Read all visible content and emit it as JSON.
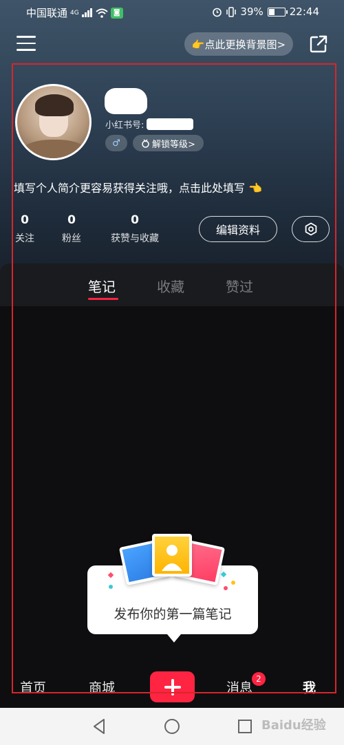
{
  "status_bar": {
    "carrier": "中国联通",
    "network": "4G",
    "battery": "39%",
    "time": "22:44"
  },
  "top_bar": {
    "change_bg_label": "👉点此更换背景图>"
  },
  "profile": {
    "redbook_id_label": "小红书号:",
    "gender_symbol": "♂",
    "unlock_level_label": "解锁等级>",
    "bio_prompt": "填写个人简介更容易获得关注哦，点击此处填写 👈"
  },
  "stats": [
    {
      "value": "0",
      "label": "关注"
    },
    {
      "value": "0",
      "label": "粉丝"
    },
    {
      "value": "0",
      "label": "获赞与收藏"
    }
  ],
  "actions": {
    "edit_profile": "编辑资料"
  },
  "tabs": [
    {
      "label": "笔记",
      "active": true
    },
    {
      "label": "收藏",
      "active": false
    },
    {
      "label": "赞过",
      "active": false
    }
  ],
  "empty_state": {
    "message": "发布你的第一篇笔记"
  },
  "bottom_nav": {
    "home": "首页",
    "mall": "商城",
    "messages": "消息",
    "messages_badge": "2",
    "me": "我"
  },
  "watermark": "Baidu经验",
  "colors": {
    "accent": "#ff2442",
    "header_bg": "#2f4256",
    "page_bg": "#0e0e10",
    "annotation_frame": "#d8262b"
  },
  "icons": {
    "menu": "hamburger-icon",
    "share": "share-external-icon",
    "settings": "gear-icon",
    "add": "plus-icon"
  }
}
